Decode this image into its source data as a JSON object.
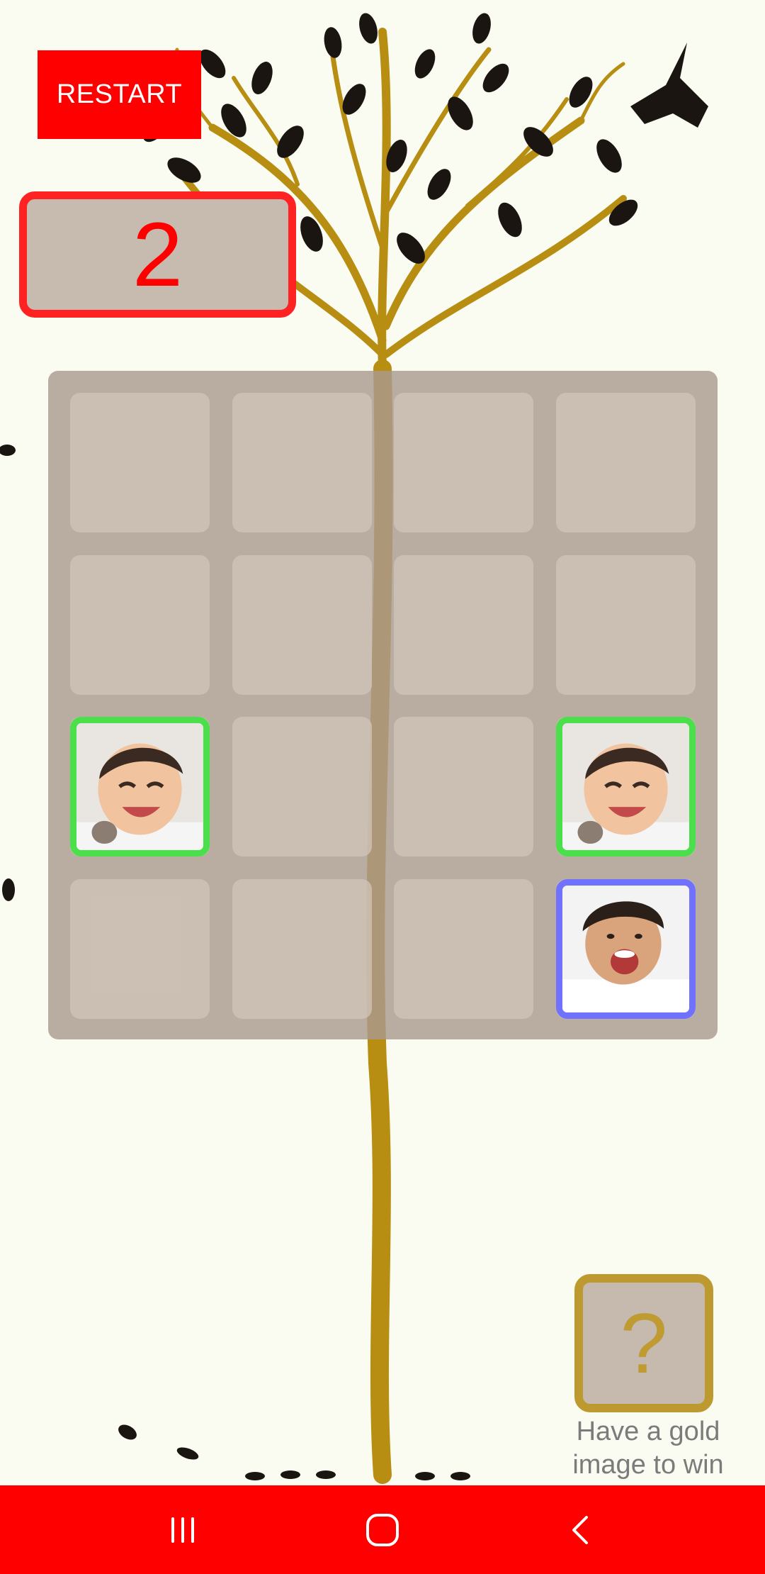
{
  "game": {
    "restart_label": "RESTART",
    "score": "2",
    "hint_symbol": "?",
    "hint_text": "Have a gold image to win"
  },
  "board": {
    "rows": 4,
    "cols": 4,
    "tiles": [
      {
        "row": 2,
        "col": 0,
        "image": "smiling-baby-photo",
        "frame_color": "#4be04b"
      },
      {
        "row": 2,
        "col": 3,
        "image": "smiling-baby-photo",
        "frame_color": "#4be04b"
      },
      {
        "row": 3,
        "col": 3,
        "image": "laughing-toddler-photo",
        "frame_color": "#7171ff"
      }
    ]
  },
  "nav": {
    "recents_icon": "recents-icon",
    "home_icon": "home-icon",
    "back_icon": "back-icon"
  },
  "colors": {
    "accent": "#ff0000",
    "background": "#fbfcf1",
    "gold": "#bd9a30"
  }
}
